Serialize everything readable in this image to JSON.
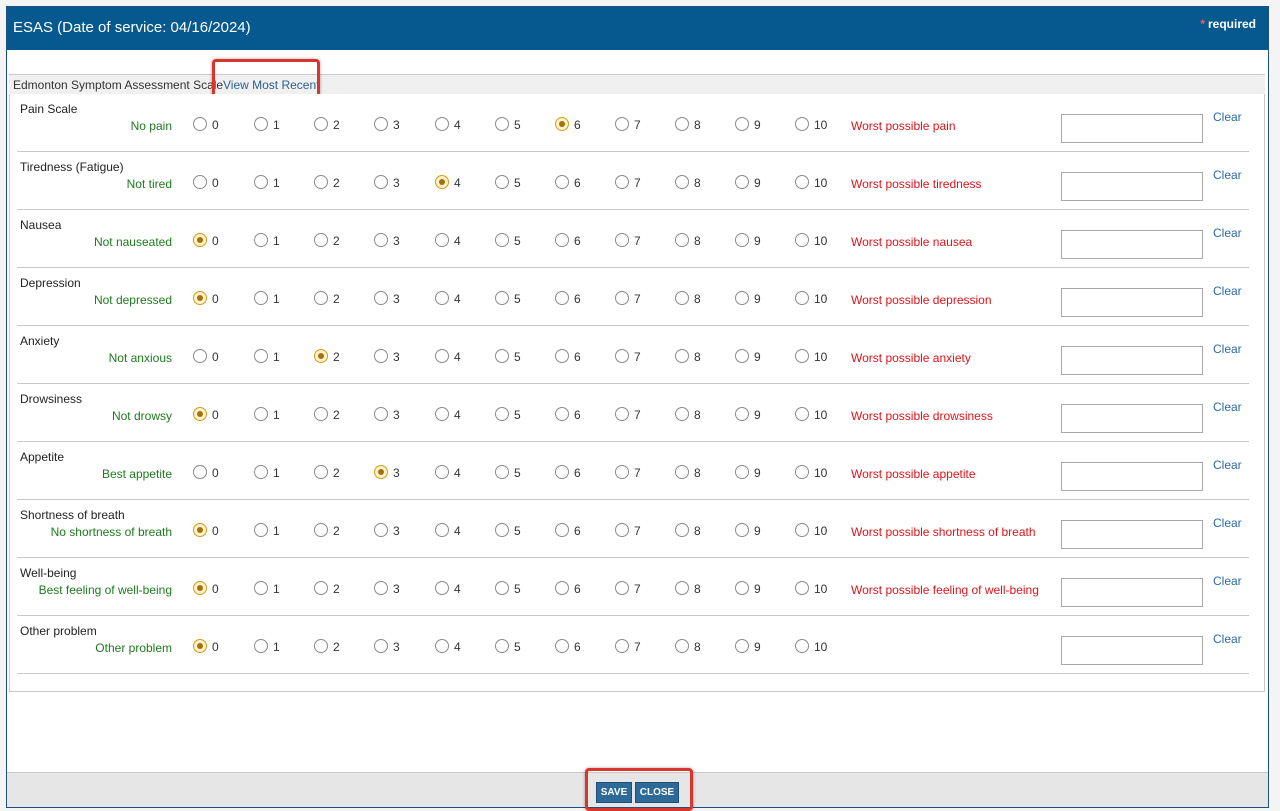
{
  "modal": {
    "title": "ESAS (Date of service: 04/16/2024)",
    "required_star": "*",
    "required_text": "required"
  },
  "scale": {
    "title": "Edmonton Symptom Assessment Scale",
    "view_recent": "View Most Recent"
  },
  "options": [
    "0",
    "1",
    "2",
    "3",
    "4",
    "5",
    "6",
    "7",
    "8",
    "9",
    "10"
  ],
  "clear_label": "Clear",
  "symptoms": [
    {
      "title": "Pain Scale",
      "low": "No pain",
      "high": "Worst possible pain",
      "selected": 6
    },
    {
      "title": "Tiredness (Fatigue)",
      "low": "Not tired",
      "high": "Worst possible tiredness",
      "selected": 4
    },
    {
      "title": "Nausea",
      "low": "Not nauseated",
      "high": "Worst possible nausea",
      "selected": 0
    },
    {
      "title": "Depression",
      "low": "Not depressed",
      "high": "Worst possible depression",
      "selected": 0
    },
    {
      "title": "Anxiety",
      "low": "Not anxious",
      "high": "Worst possible anxiety",
      "selected": 2
    },
    {
      "title": "Drowsiness",
      "low": "Not drowsy",
      "high": "Worst possible drowsiness",
      "selected": 0
    },
    {
      "title": "Appetite",
      "low": "Best appetite",
      "high": "Worst possible appetite",
      "selected": 3
    },
    {
      "title": "Shortness of breath",
      "low": "No shortness of breath",
      "high": "Worst possible shortness of breath",
      "selected": 0
    },
    {
      "title": "Well-being",
      "low": "Best feeling of well-being",
      "high": "Worst possible feeling of well-being",
      "selected": 0
    },
    {
      "title": "Other problem",
      "low": "Other problem",
      "high": "",
      "selected": 0
    }
  ],
  "buttons": {
    "save": "SAVE",
    "close": "CLOSE"
  },
  "colors": {
    "header": "#05598f",
    "low_label": "#1e7a1e",
    "high_label": "#e0141a",
    "highlight": "#d9352a",
    "button": "#2d6a99"
  }
}
